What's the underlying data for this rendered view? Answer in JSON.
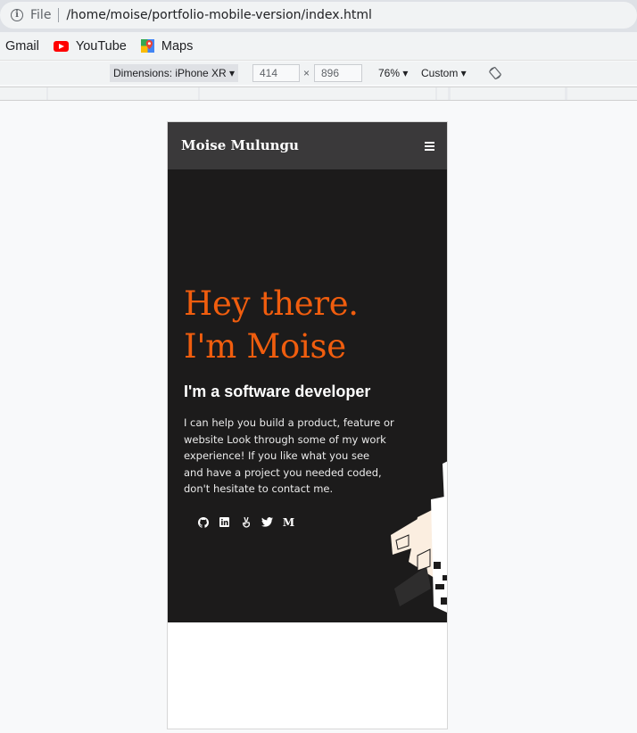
{
  "browser": {
    "info_icon": "info-icon",
    "scheme": "File",
    "url": "/home/moise/portfolio-mobile-version/index.html"
  },
  "bookmarks": [
    {
      "label": "Gmail",
      "icon": ""
    },
    {
      "label": "YouTube",
      "icon": "youtube-icon"
    },
    {
      "label": "Maps",
      "icon": "maps-icon"
    }
  ],
  "devtools": {
    "dimensions_label": "Dimensions: iPhone XR ▾",
    "width": "414",
    "times": "×",
    "height": "896",
    "zoom": "76% ▾",
    "throttle": "Custom ▾"
  },
  "site": {
    "brand": "Moise Mulungu",
    "menu_icon": "hamburger-menu-icon",
    "hero_line1": "Hey there.",
    "hero_line2": "I'm Moise",
    "subtitle": "I'm a software developer",
    "intro_lines": [
      "I can help you build a product, feature or",
      "website Look through some of my work",
      "experience! If you like what you see",
      "and have a project you needed coded,",
      "don't hesitate to contact me."
    ],
    "socials": [
      "github-icon",
      "linkedin-icon",
      "angellist-icon",
      "twitter-icon",
      "medium-icon"
    ],
    "medium_letter": "M"
  },
  "colors": {
    "accent": "#f05d0e",
    "hero_bg": "#1c1b1b",
    "nav_bg": "#3a393a"
  }
}
